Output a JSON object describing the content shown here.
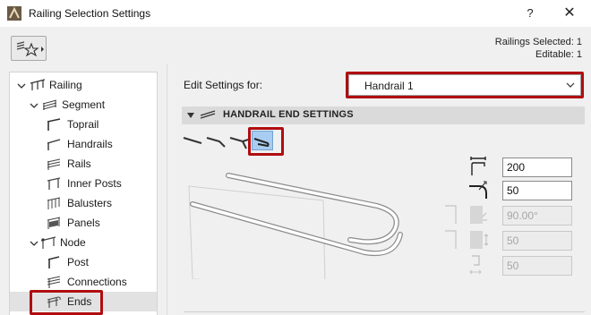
{
  "window": {
    "title": "Railing Selection Settings",
    "help_label": "?",
    "close_label": "✕"
  },
  "selection": {
    "selected_text": "Railings Selected: 1",
    "editable_text": "Editable: 1"
  },
  "tree": {
    "items": [
      {
        "label": "Railing",
        "icon": "railing-icon",
        "expanded": true
      },
      {
        "label": "Segment",
        "icon": "segment-icon",
        "expanded": true
      },
      {
        "label": "Toprail",
        "icon": "toprail-icon"
      },
      {
        "label": "Handrails",
        "icon": "handrails-icon"
      },
      {
        "label": "Rails",
        "icon": "rails-icon"
      },
      {
        "label": "Inner Posts",
        "icon": "inner-posts-icon"
      },
      {
        "label": "Balusters",
        "icon": "balusters-icon"
      },
      {
        "label": "Panels",
        "icon": "panels-icon"
      },
      {
        "label": "Node",
        "icon": "node-icon",
        "expanded": true
      },
      {
        "label": "Post",
        "icon": "post-icon"
      },
      {
        "label": "Connections",
        "icon": "connections-icon"
      },
      {
        "label": "Ends",
        "icon": "ends-icon",
        "selected": true
      }
    ]
  },
  "editor": {
    "edit_label": "Edit Settings for:",
    "edit_value": "Handrail 1",
    "section_title": "HANDRAIL END SETTINGS"
  },
  "end_options": [
    "end-straight-icon",
    "end-bent-down-icon",
    "end-bent-return-icon",
    "end-loop-icon"
  ],
  "active_end_option": 3,
  "params": {
    "length": "200",
    "radius": "50",
    "angle": "90.00°",
    "height": "50",
    "offset": "50"
  },
  "colors": {
    "highlight": "#b00d10",
    "selected_option": "#a9cdf0",
    "section_bg": "#dadada"
  }
}
